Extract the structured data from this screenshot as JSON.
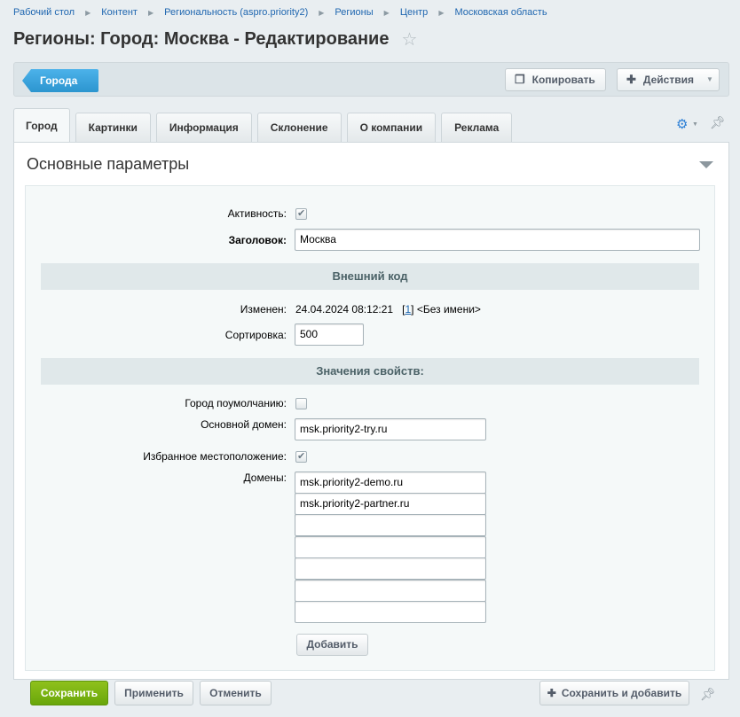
{
  "breadcrumb": [
    "Рабочий стол",
    "Контент",
    "Региональность (aspro.priority2)",
    "Регионы",
    "Центр",
    "Московская область"
  ],
  "page_title": "Регионы: Город: Москва - Редактирование",
  "toolbar": {
    "back_label": "Города",
    "copy_label": "Копировать",
    "actions_label": "Действия"
  },
  "tabs": [
    "Город",
    "Картинки",
    "Информация",
    "Склонение",
    "О компании",
    "Реклама"
  ],
  "active_tab": "Город",
  "section_title": "Основные параметры",
  "form": {
    "active_label": "Активность:",
    "active_checked": true,
    "title_label": "Заголовок:",
    "title_value": "Москва",
    "external_code_header": "Внешний код",
    "modified_label": "Изменен:",
    "modified_value": "24.04.2024 08:12:21",
    "modified_user_link": "1",
    "modified_user_name": "<Без имени>",
    "sort_label": "Сортировка:",
    "sort_value": "500",
    "properties_header": "Значения свойств:",
    "default_city_label": "Город поумолчанию:",
    "default_city_checked": false,
    "main_domain_label": "Основной домен:",
    "main_domain_value": "msk.priority2-try.ru",
    "favorite_label": "Избранное местоположение:",
    "favorite_checked": true,
    "domains_label": "Домены:",
    "domains": [
      "msk.priority2-demo.ru",
      "msk.priority2-partner.ru",
      "",
      "",
      "",
      "",
      ""
    ],
    "add_label": "Добавить"
  },
  "footer": {
    "save_label": "Сохранить",
    "apply_label": "Применить",
    "cancel_label": "Отменить",
    "save_add_label": "Сохранить и добавить"
  },
  "colors": {
    "accent_blue": "#2c95cf",
    "save_green": "#7bb313",
    "link": "#2067b0"
  }
}
